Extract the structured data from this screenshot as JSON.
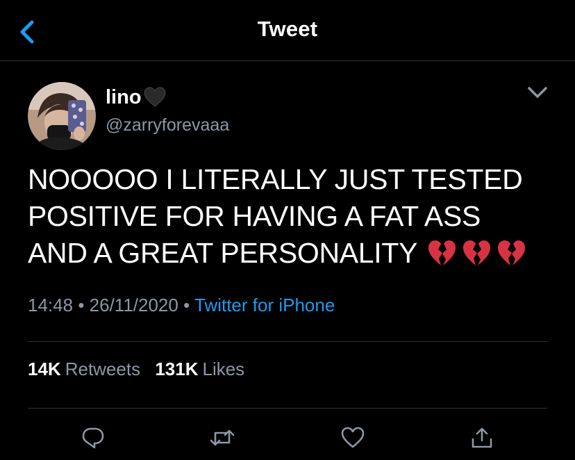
{
  "nav": {
    "title": "Tweet",
    "back_icon": "chevron-left-icon"
  },
  "author": {
    "display_name": "lino",
    "name_emoji": "black-heart",
    "handle": "@zarryforevaaa"
  },
  "tweet": {
    "lines": [
      "NOOOOO I LITERALLY JUST TESTED",
      "POSITIVE FOR HAVING A FAT ASS",
      "AND A GREAT PERSONALITY"
    ],
    "emojis": [
      "broken-heart",
      "broken-heart",
      "broken-heart"
    ]
  },
  "meta": {
    "time": "14:48",
    "separator": "•",
    "date": "26/11/2020",
    "source": "Twitter for iPhone"
  },
  "stats": {
    "retweets_count": "14K",
    "retweets_label": "Retweets",
    "likes_count": "131K",
    "likes_label": "Likes"
  },
  "actions": {
    "reply_icon": "reply-icon",
    "retweet_icon": "retweet-icon",
    "like_icon": "heart-icon",
    "share_icon": "share-icon"
  },
  "colors": {
    "background": "#000000",
    "text": "#ffffff",
    "secondary": "#8b98a5",
    "accent": "#1d9bf0",
    "divider": "#2f3336",
    "broken_heart": "#d83344"
  }
}
